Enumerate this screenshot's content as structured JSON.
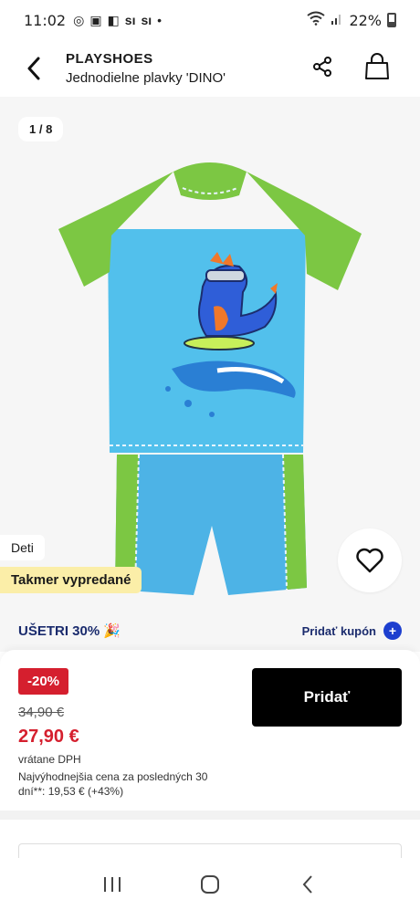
{
  "status": {
    "time": "11:02",
    "battery": "22%"
  },
  "header": {
    "brand": "PLAYSHOES",
    "product_name": "Jednodielne plavky 'DINO'"
  },
  "gallery": {
    "counter": "1 / 8",
    "tag_kids": "Deti",
    "tag_sold": "Takmer vypredané"
  },
  "promo": {
    "save_label": "UŠETRI 30% 🎉",
    "coupon_label": "Pridať kupón"
  },
  "price": {
    "discount": "-20%",
    "old_price": "34,90 €",
    "new_price": "27,90 €",
    "tax_note": "vrátane DPH",
    "lowest_note": "Najvýhodnejšia cena za posledných 30 dní**: 19,53 € (+43%)",
    "add_label": "Pridať"
  },
  "colors": {
    "accent_red": "#d51f2e",
    "navy": "#1a2b6d",
    "coupon_blue": "#1d3fcf",
    "sold_bg": "#fbeea8"
  }
}
